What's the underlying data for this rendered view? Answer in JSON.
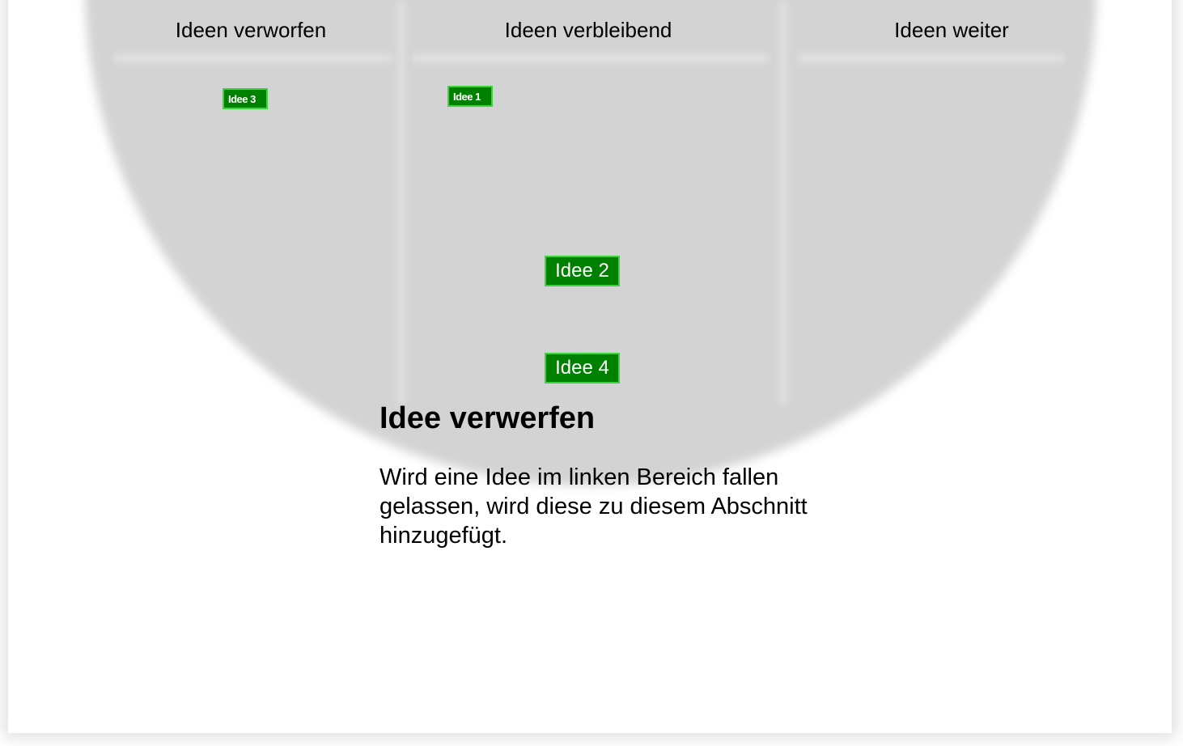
{
  "columns": {
    "discarded": {
      "title": "Ideen verworfen"
    },
    "remaining": {
      "title": "Ideen verbleibend"
    },
    "forward": {
      "title": "Ideen weiter"
    }
  },
  "ideas": {
    "idea_3": {
      "label": "Idee 3",
      "column": "discarded"
    },
    "idea_1": {
      "label": "Idee 1",
      "column": "remaining"
    },
    "idea_2": {
      "label": "Idee 2",
      "column": "remaining"
    },
    "idea_4": {
      "label": "Idee 4",
      "column": "remaining"
    }
  },
  "info": {
    "title": "Idee verwerfen",
    "text": "Wird eine Idee im linken Bereich fallen gelassen, wird diese zu diesem Abschnitt hinzugefügt."
  },
  "colors": {
    "background": "#ffffff",
    "drop_zone": "#d3d3d3",
    "card_fill": "#008000",
    "card_border": "#3bd43b",
    "card_text": "#ffffff"
  }
}
